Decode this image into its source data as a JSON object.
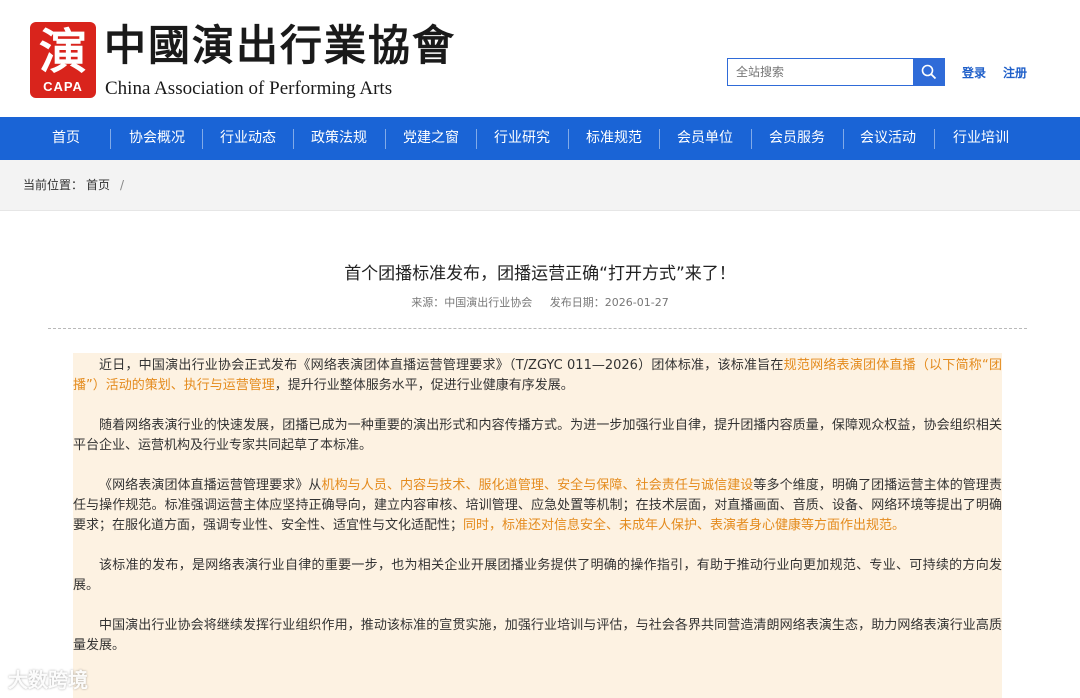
{
  "logo": {
    "seal_char": "演",
    "seal_abbr": "CAPA",
    "name_cn": "中國演出行業協會",
    "name_en": "China Association of Performing Arts"
  },
  "search": {
    "placeholder": "全站搜索"
  },
  "header_links": {
    "login": "登录",
    "register": "注册"
  },
  "nav": [
    "首页",
    "协会概况",
    "行业动态",
    "政策法规",
    "党建之窗",
    "行业研究",
    "标准规范",
    "会员单位",
    "会员服务",
    "会议活动",
    "行业培训"
  ],
  "breadcrumb": {
    "prefix": "当前位置：",
    "home": "首页",
    "sep": "/"
  },
  "article": {
    "title": "首个团播标准发布，团播运营正确“打开方式”来了！",
    "source_label": "来源：",
    "source": "中国演出行业协会",
    "date_label": "发布日期：",
    "date": "2026-01-27",
    "p1a": "近日，中国演出行业协会正式发布《网络表演团体直播运营管理要求》（T/ZGYC 011—2026）团体标准，该标准旨在",
    "p1b": "规范网络表演团体直播（以下简称“团播”）活动的策划、执行与运营管理",
    "p1c": "，提升行业整体服务水平，促进行业健康有序发展。",
    "p2": "随着网络表演行业的快速发展，团播已成为一种重要的演出形式和内容传播方式。为进一步加强行业自律，提升团播内容质量，保障观众权益，协会组织相关平台企业、运营机构及行业专家共同起草了本标准。",
    "p3a": "《网络表演团体直播运营管理要求》从",
    "p3b": "机构与人员、内容与技术、服化道管理、安全与保障、社会责任与诚信建设",
    "p3c": "等多个维度，明确了团播运营主体的管理责任与操作规范。标准强调运营主体应坚持正确导向，建立内容审核、培训管理、应急处置等机制；在技术层面，对直播画面、音质、设备、网络环境等提出了明确要求；在服化道方面，强调专业性、安全性、适宜性与文化适配性；",
    "p3d": "同时，标准还对信息安全、未成年人保护、表演者身心健康等方面作出规范。",
    "p4": "该标准的发布，是网络表演行业自律的重要一步，也为相关企业开展团播业务提供了明确的操作指引，有助于推动行业向更加规范、专业、可持续的方向发展。",
    "p5": "中国演出行业协会将继续发挥行业组织作用，推动该标准的宣贯实施，加强行业培训与评估，与社会各界共同营造清朗网络表演生态，助力网络表演行业高质量发展。"
  },
  "watermark": "大数跨境",
  "colors": {
    "nav_bg": "#1a64d6",
    "highlight": "#e48b1d",
    "content_bg": "#fdf2e2",
    "seal": "#d9241c"
  }
}
